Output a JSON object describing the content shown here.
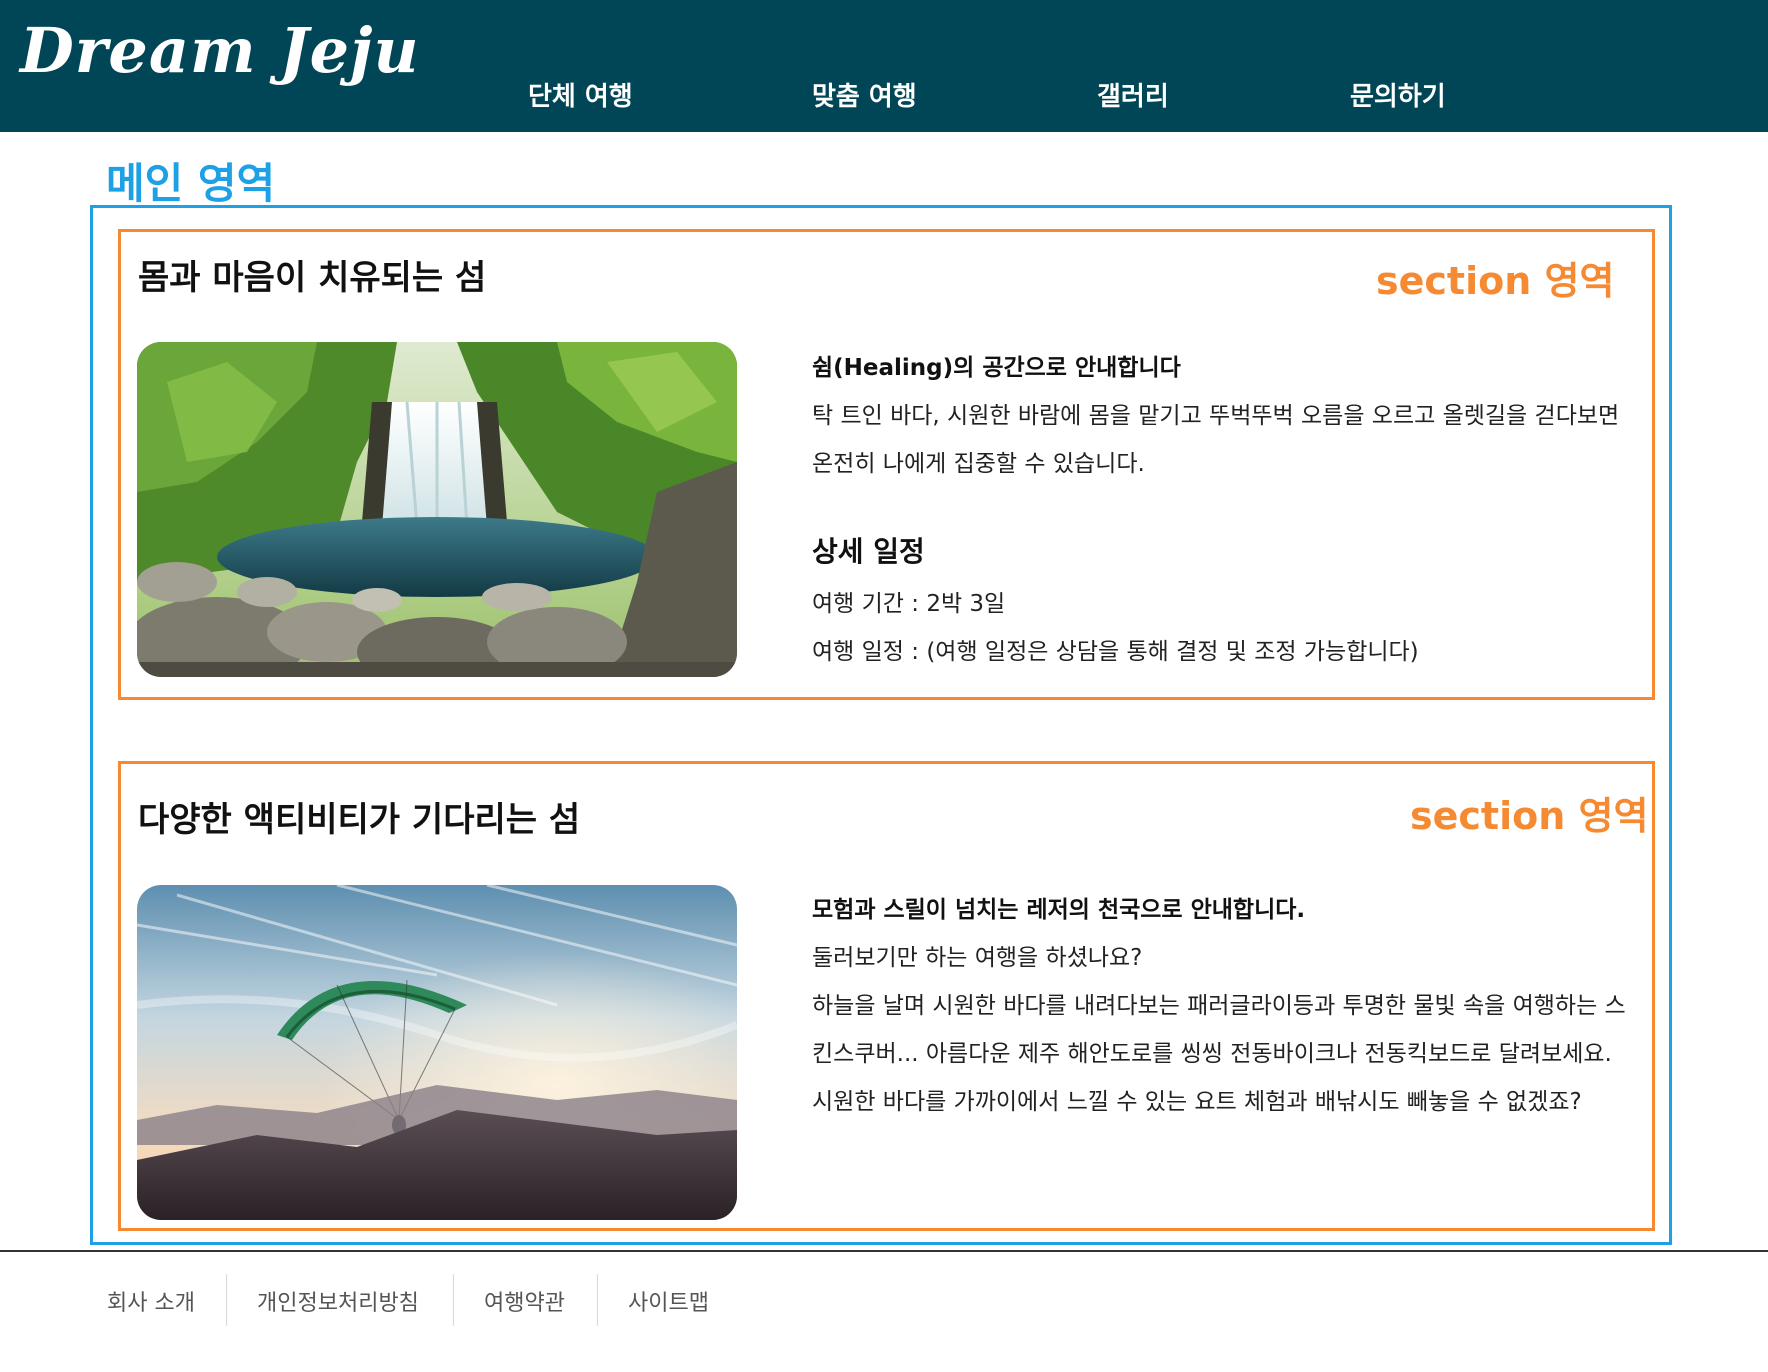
{
  "header": {
    "logo": "Dream Jeju",
    "nav": [
      "단체 여행",
      "맞춤 여행",
      "갤러리",
      "문의하기"
    ]
  },
  "main": {
    "label": "메인 영역",
    "sections": [
      {
        "label": "section 영역",
        "title": "몸과 마음이 치유되는 섬",
        "image": "waterfall-photo",
        "lead": "쉼(Healing)의 공간으로 안내합니다",
        "body": "탁 트인 바다, 시원한 바람에 몸을 맡기고 뚜벅뚜벅 오름을 오르고 올렛길을 걷다보면 온전히 나에게 집중할 수 있습니다.",
        "detail_title": "상세 일정",
        "detail_period": "여행 기간 : 2박 3일",
        "detail_schedule": "여행 일정 : (여행 일정은 상담을 통해 결정 및 조정 가능합니다)"
      },
      {
        "label": "section 영역",
        "title": "다양한 액티비티가 기다리는 섬",
        "image": "paragliding-photo",
        "lead": "모험과 스릴이 넘치는 레저의 천국으로 안내합니다.",
        "line1": "둘러보기만 하는 여행을 하셨나요?",
        "body": "하늘을 날며 시원한 바다를 내려다보는 패러글라이등과 투명한 물빛 속을 여행하는 스킨스쿠버... 아름다운 제주 해안도로를 씽씽 전동바이크나 전동킥보드로 달려보세요. 시원한 바다를 가까이에서 느낄 수 있는 요트 체험과 배낚시도 빼놓을 수 없겠죠?"
      }
    ]
  },
  "footer": {
    "links": [
      "회사 소개",
      "개인정보처리방침",
      "여행약관",
      "사이트맵"
    ]
  },
  "colors": {
    "header_bg": "#004657",
    "main_border": "#1ea0e6",
    "section_border": "#f58a32"
  }
}
